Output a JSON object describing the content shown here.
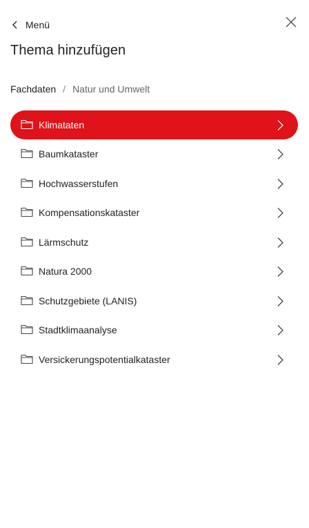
{
  "header": {
    "back_label": "Menü",
    "back_icon": "chevron-left-icon",
    "close_icon": "close-icon"
  },
  "title": "Thema hinzufügen",
  "breadcrumb": {
    "root": "Fachdaten",
    "separator": "/",
    "current": "Natur und Umwelt"
  },
  "colors": {
    "accent": "#e0121a",
    "text": "#222222",
    "muted": "#666666"
  },
  "items": [
    {
      "label": "Klimataten",
      "icon": "folder-icon",
      "active": true
    },
    {
      "label": "Baumkataster",
      "icon": "folder-icon",
      "active": false
    },
    {
      "label": "Hochwasserstufen",
      "icon": "folder-icon",
      "active": false
    },
    {
      "label": "Kompensationskataster",
      "icon": "folder-icon",
      "active": false
    },
    {
      "label": "Lärmschutz",
      "icon": "folder-icon",
      "active": false
    },
    {
      "label": "Natura 2000",
      "icon": "folder-icon",
      "active": false
    },
    {
      "label": "Schutzgebiete (LANIS)",
      "icon": "folder-icon",
      "active": false
    },
    {
      "label": "Stadtklimaanalyse",
      "icon": "folder-icon",
      "active": false
    },
    {
      "label": "Versickerungspotentialkataster",
      "icon": "folder-icon",
      "active": false
    }
  ]
}
